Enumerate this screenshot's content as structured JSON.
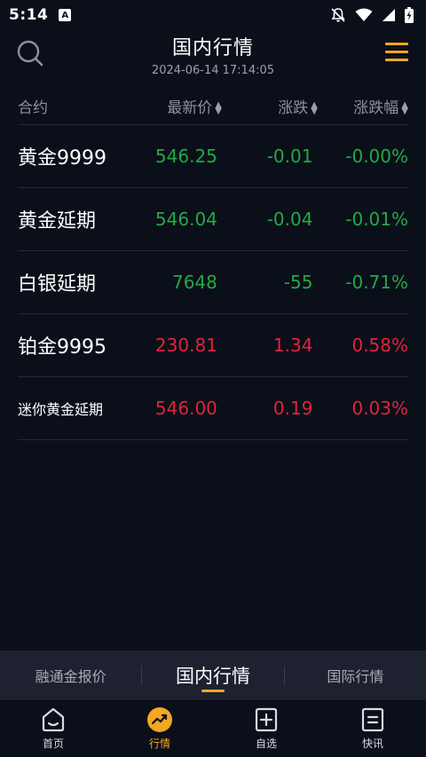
{
  "status": {
    "time": "5:14",
    "notif_glyph": "A"
  },
  "header": {
    "title": "国内行情",
    "timestamp": "2024-06-14 17:14:05"
  },
  "columns": {
    "contract": "合约",
    "latest_price": "最新价",
    "change": "涨跌",
    "change_pct": "涨跌幅"
  },
  "rows": [
    {
      "name": "黄金9999",
      "price": "546.25",
      "change": "-0.01",
      "pct": "-0.00%",
      "trend": "down"
    },
    {
      "name": "黄金延期",
      "price": "546.04",
      "change": "-0.04",
      "pct": "-0.01%",
      "trend": "down"
    },
    {
      "name": "白银延期",
      "price": "7648",
      "change": "-55",
      "pct": "-0.71%",
      "trend": "down"
    },
    {
      "name": "铂金9995",
      "price": "230.81",
      "change": "1.34",
      "pct": "0.58%",
      "trend": "up"
    },
    {
      "name": "迷你黄金延期",
      "price": "546.00",
      "change": "0.19",
      "pct": "0.03%",
      "trend": "up"
    }
  ],
  "subtabs": [
    "融通金报价",
    "国内行情",
    "国际行情"
  ],
  "tabbar": [
    "首页",
    "行情",
    "自选",
    "快讯"
  ],
  "colors": {
    "accent": "#f5a623",
    "up": "#e0243b",
    "down": "#24a844",
    "background": "#0b0f1a"
  }
}
